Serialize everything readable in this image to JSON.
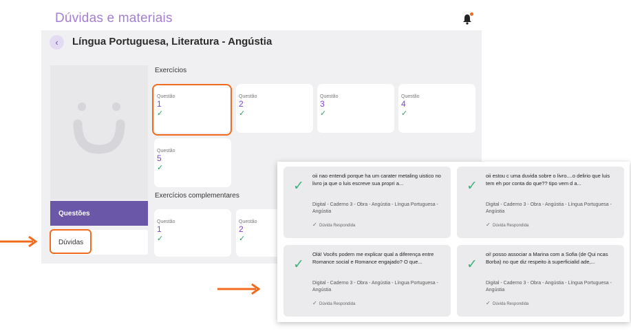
{
  "app": {
    "title": "Dúvidas e materiais"
  },
  "page": {
    "back_icon": "chevron-left-icon",
    "title": "Língua Portuguesa, Literatura - Angústia"
  },
  "sidebar": {
    "questoes_label": "Questões",
    "duvidas_label": "Dúvidas"
  },
  "exercicios": {
    "label": "Exercícios",
    "cards": [
      {
        "label": "Questão",
        "number": "1",
        "check": "✓"
      },
      {
        "label": "Questão",
        "number": "2",
        "check": "✓"
      },
      {
        "label": "Questão",
        "number": "3",
        "check": "✓"
      },
      {
        "label": "Questão",
        "number": "4",
        "check": "✓"
      },
      {
        "label": "Questão",
        "number": "5",
        "check": "✓"
      }
    ]
  },
  "complementares": {
    "label": "Exercícios complementares",
    "cards": [
      {
        "label": "Questão",
        "number": "1",
        "check": "✓"
      },
      {
        "label": "Questão",
        "number": "2",
        "check": "✓"
      }
    ]
  },
  "duvidas": [
    {
      "text": "oii nao entendi porque ha um carater metaling uistico no livro ja que o luis escreve sua propri a...",
      "meta": "Digital - Caderno 3 - Obra - Angústia - Língua Portuguesa - Angústia",
      "status": "Dúvida Respondida"
    },
    {
      "text": "oii estou c uma duvida sobre o livro....o delirio que luis tem eh por conta do que?? tipo vem d a...",
      "meta": "Digital - Caderno 3 - Obra - Angústia - Língua Portuguesa - Angústia",
      "status": "Dúvida Respondida"
    },
    {
      "text": "Olá! Vocês podem me explicar qual a diferença entre Romance social e Romance engajado? O que...",
      "meta": "Digital - Caderno 3 - Obra - Angústia - Língua Portuguesa - Angústia",
      "status": "Dúvida Respondida"
    },
    {
      "text": "oi! posso associar a Marina com a Sofia (de Qui ncas Borba) no que diz respeito à superficialid ade,...",
      "meta": "Digital - Caderno 3 - Obra - Angústia - Língua Portuguesa - Angústia",
      "status": "Dúvida Respondida"
    }
  ],
  "colors": {
    "accent": "#6b57a8",
    "highlight": "#f26b1d",
    "check": "#2e9e5f",
    "number": "#7c3fd6"
  }
}
